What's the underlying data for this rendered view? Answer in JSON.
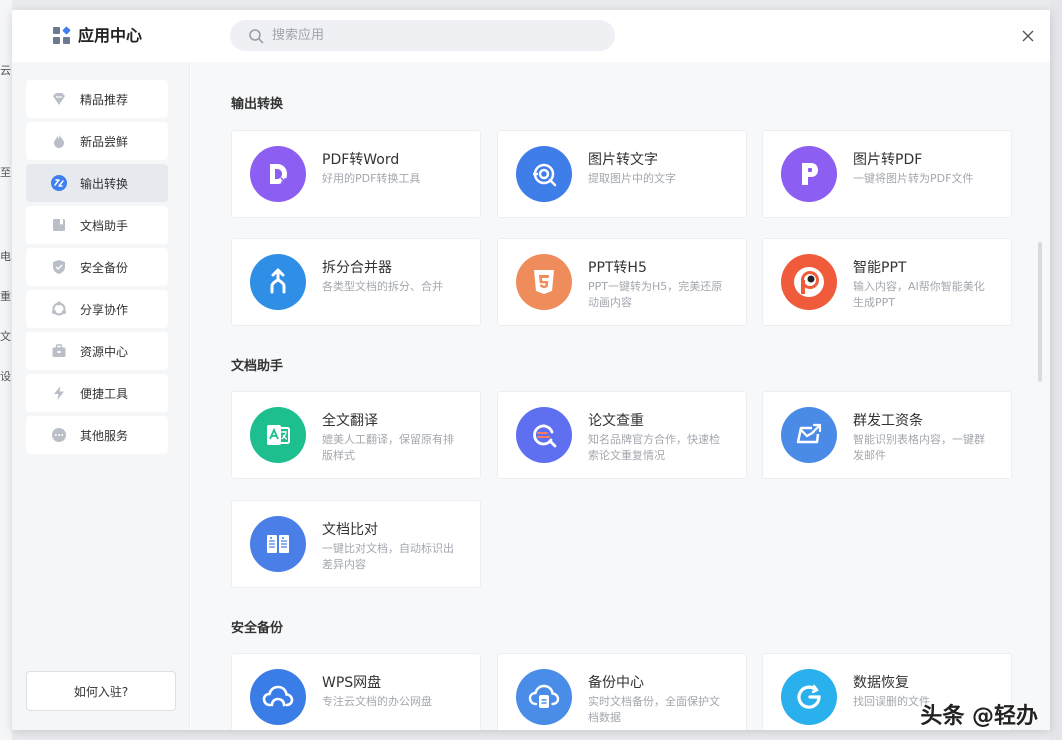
{
  "header": {
    "title": "应用中心",
    "search_placeholder": "搜索应用"
  },
  "background_glyphs": [
    "云",
    "至",
    "电",
    "重",
    "文",
    "设"
  ],
  "sidebar": {
    "items": [
      {
        "label": "精品推荐",
        "icon": "diamond-icon"
      },
      {
        "label": "新品尝鲜",
        "icon": "flame-icon"
      },
      {
        "label": "输出转换",
        "icon": "convert-icon",
        "active": true
      },
      {
        "label": "文档助手",
        "icon": "bookmark-icon"
      },
      {
        "label": "安全备份",
        "icon": "shield-icon"
      },
      {
        "label": "分享协作",
        "icon": "share-cycle-icon"
      },
      {
        "label": "资源中心",
        "icon": "briefcase-icon"
      },
      {
        "label": "便捷工具",
        "icon": "lightning-icon"
      },
      {
        "label": "其他服务",
        "icon": "more-dots-icon"
      }
    ],
    "join_label": "如何入驻?"
  },
  "sections": [
    {
      "title": "输出转换",
      "cards": [
        {
          "title": "PDF转Word",
          "desc": "好用的PDF转换工具",
          "icon": "pdf-to-word-icon",
          "color": "#8d5ef2"
        },
        {
          "title": "图片转文字",
          "desc": "提取图片中的文字",
          "icon": "image-to-text-icon",
          "color": "#3f7de8"
        },
        {
          "title": "图片转PDF",
          "desc": "一键将图片转为PDF文件",
          "icon": "image-to-pdf-icon",
          "color": "#8d5ef2"
        },
        {
          "title": "拆分合并器",
          "desc": "各类型文档的拆分、合并",
          "icon": "split-merge-icon",
          "color": "#2f8fe6"
        },
        {
          "title": "PPT转H5",
          "desc": "PPT一键转为H5，完美还原动画内容",
          "icon": "html5-icon",
          "color": "#ee8c5c"
        },
        {
          "title": "智能PPT",
          "desc": "输入内容，AI帮你智能美化生成PPT",
          "icon": "smart-ppt-icon",
          "color": "#ef5b3b"
        }
      ]
    },
    {
      "title": "文档助手",
      "cards": [
        {
          "title": "全文翻译",
          "desc": "媲美人工翻译，保留原有排版样式",
          "icon": "translate-icon",
          "color": "#1dbf8e"
        },
        {
          "title": "论文查重",
          "desc": "知名品牌官方合作，快速检索论文重复情况",
          "icon": "paper-check-icon",
          "color": "#5e6ff0"
        },
        {
          "title": "群发工资条",
          "desc": "智能识别表格内容，一键群发邮件",
          "icon": "send-mail-icon",
          "color": "#4a8be8"
        },
        {
          "title": "文档比对",
          "desc": "一键比对文档，自动标识出差异内容",
          "icon": "compare-doc-icon",
          "color": "#4a7fe8"
        }
      ]
    },
    {
      "title": "安全备份",
      "cards": [
        {
          "title": "WPS网盘",
          "desc": "专注云文档的办公网盘",
          "icon": "cloud-drive-icon",
          "color": "#3b7de6"
        },
        {
          "title": "备份中心",
          "desc": "实时文档备份，全面保护文档数据",
          "icon": "backup-center-icon",
          "color": "#4a8de8"
        },
        {
          "title": "数据恢复",
          "desc": "找回误删的文件",
          "icon": "data-recovery-icon",
          "color": "#2ab0ec"
        }
      ]
    }
  ],
  "watermark": "头条 @轻办"
}
